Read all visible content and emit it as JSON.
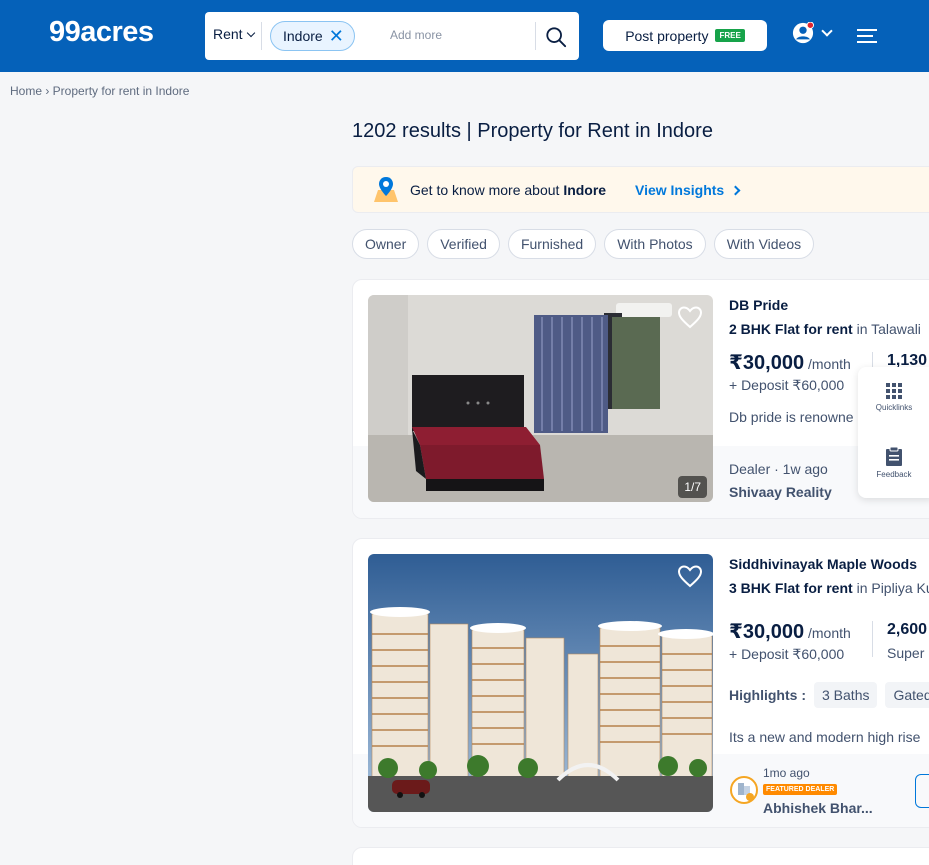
{
  "header": {
    "logo": "99acres",
    "search": {
      "mode": "Rent",
      "city_chip": "Indore",
      "placeholder": "Add more"
    },
    "post_property": {
      "label": "Post property",
      "badge": "FREE"
    }
  },
  "breadcrumb": "Home › Property for rent in Indore",
  "results_title": "1202 results | Property for Rent in Indore",
  "insights": {
    "text": "Get to know more about",
    "city": "Indore",
    "link": "View Insights"
  },
  "filters": [
    "Owner",
    "Verified",
    "Furnished",
    "With Photos",
    "With Videos"
  ],
  "listings": [
    {
      "name": "DB Pride",
      "type_bold": "2 BHK Flat for rent",
      "location": " in Talawali",
      "price": "₹30,000",
      "per": " /month",
      "deposit": "+ Deposit ₹60,000",
      "area": "1,130",
      "description": "Db pride is renowne",
      "photo_count": "1/7",
      "poster_meta": "Dealer · 1w ago",
      "poster": "Shivaay Reality"
    },
    {
      "name": "Siddhivinayak Maple Woods",
      "type_bold": "3 BHK Flat for rent",
      "location": " in Pipliya Ku",
      "price": "₹30,000",
      "per": " /month",
      "deposit": "+ Deposit ₹60,000",
      "area": "2,600",
      "area_sub": "Super",
      "highlights_label": "Highlights :",
      "highlights": [
        "3 Baths",
        "Gated"
      ],
      "description": "Its a new and modern high rise",
      "poster_meta": "1mo ago",
      "featured_badge": "FEATURED DEALER",
      "poster": "Abhishek Bhar..."
    }
  ],
  "side_panel": {
    "quicklinks": "Quicklinks",
    "feedback": "Feedback"
  },
  "colors": {
    "header_bg": "#0561b9",
    "link": "#0078db",
    "free_badge": "#17a34a",
    "featured": "#ff8a00"
  }
}
